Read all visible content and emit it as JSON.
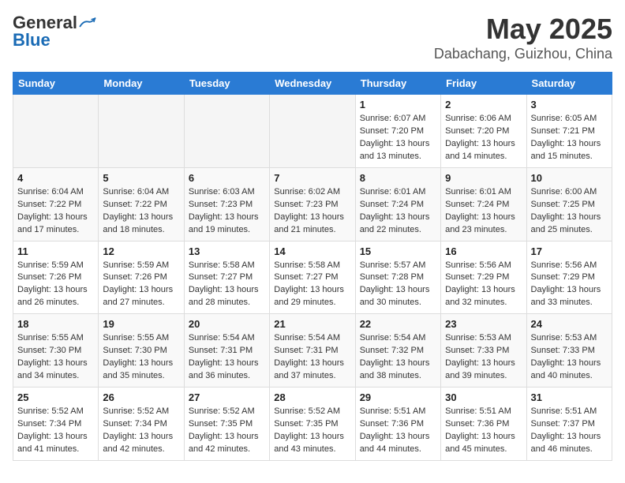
{
  "header": {
    "logo_general": "General",
    "logo_blue": "Blue",
    "month_year": "May 2025",
    "location": "Dabachang, Guizhou, China"
  },
  "days_of_week": [
    "Sunday",
    "Monday",
    "Tuesday",
    "Wednesday",
    "Thursday",
    "Friday",
    "Saturday"
  ],
  "weeks": [
    [
      {
        "day": "",
        "empty": true
      },
      {
        "day": "",
        "empty": true
      },
      {
        "day": "",
        "empty": true
      },
      {
        "day": "",
        "empty": true
      },
      {
        "day": "1",
        "sunrise": "6:07 AM",
        "sunset": "7:20 PM",
        "daylight": "13 hours and 13 minutes."
      },
      {
        "day": "2",
        "sunrise": "6:06 AM",
        "sunset": "7:20 PM",
        "daylight": "13 hours and 14 minutes."
      },
      {
        "day": "3",
        "sunrise": "6:05 AM",
        "sunset": "7:21 PM",
        "daylight": "13 hours and 15 minutes."
      }
    ],
    [
      {
        "day": "4",
        "sunrise": "6:04 AM",
        "sunset": "7:22 PM",
        "daylight": "13 hours and 17 minutes."
      },
      {
        "day": "5",
        "sunrise": "6:04 AM",
        "sunset": "7:22 PM",
        "daylight": "13 hours and 18 minutes."
      },
      {
        "day": "6",
        "sunrise": "6:03 AM",
        "sunset": "7:23 PM",
        "daylight": "13 hours and 19 minutes."
      },
      {
        "day": "7",
        "sunrise": "6:02 AM",
        "sunset": "7:23 PM",
        "daylight": "13 hours and 21 minutes."
      },
      {
        "day": "8",
        "sunrise": "6:01 AM",
        "sunset": "7:24 PM",
        "daylight": "13 hours and 22 minutes."
      },
      {
        "day": "9",
        "sunrise": "6:01 AM",
        "sunset": "7:24 PM",
        "daylight": "13 hours and 23 minutes."
      },
      {
        "day": "10",
        "sunrise": "6:00 AM",
        "sunset": "7:25 PM",
        "daylight": "13 hours and 25 minutes."
      }
    ],
    [
      {
        "day": "11",
        "sunrise": "5:59 AM",
        "sunset": "7:26 PM",
        "daylight": "13 hours and 26 minutes."
      },
      {
        "day": "12",
        "sunrise": "5:59 AM",
        "sunset": "7:26 PM",
        "daylight": "13 hours and 27 minutes."
      },
      {
        "day": "13",
        "sunrise": "5:58 AM",
        "sunset": "7:27 PM",
        "daylight": "13 hours and 28 minutes."
      },
      {
        "day": "14",
        "sunrise": "5:58 AM",
        "sunset": "7:27 PM",
        "daylight": "13 hours and 29 minutes."
      },
      {
        "day": "15",
        "sunrise": "5:57 AM",
        "sunset": "7:28 PM",
        "daylight": "13 hours and 30 minutes."
      },
      {
        "day": "16",
        "sunrise": "5:56 AM",
        "sunset": "7:29 PM",
        "daylight": "13 hours and 32 minutes."
      },
      {
        "day": "17",
        "sunrise": "5:56 AM",
        "sunset": "7:29 PM",
        "daylight": "13 hours and 33 minutes."
      }
    ],
    [
      {
        "day": "18",
        "sunrise": "5:55 AM",
        "sunset": "7:30 PM",
        "daylight": "13 hours and 34 minutes."
      },
      {
        "day": "19",
        "sunrise": "5:55 AM",
        "sunset": "7:30 PM",
        "daylight": "13 hours and 35 minutes."
      },
      {
        "day": "20",
        "sunrise": "5:54 AM",
        "sunset": "7:31 PM",
        "daylight": "13 hours and 36 minutes."
      },
      {
        "day": "21",
        "sunrise": "5:54 AM",
        "sunset": "7:31 PM",
        "daylight": "13 hours and 37 minutes."
      },
      {
        "day": "22",
        "sunrise": "5:54 AM",
        "sunset": "7:32 PM",
        "daylight": "13 hours and 38 minutes."
      },
      {
        "day": "23",
        "sunrise": "5:53 AM",
        "sunset": "7:33 PM",
        "daylight": "13 hours and 39 minutes."
      },
      {
        "day": "24",
        "sunrise": "5:53 AM",
        "sunset": "7:33 PM",
        "daylight": "13 hours and 40 minutes."
      }
    ],
    [
      {
        "day": "25",
        "sunrise": "5:52 AM",
        "sunset": "7:34 PM",
        "daylight": "13 hours and 41 minutes."
      },
      {
        "day": "26",
        "sunrise": "5:52 AM",
        "sunset": "7:34 PM",
        "daylight": "13 hours and 42 minutes."
      },
      {
        "day": "27",
        "sunrise": "5:52 AM",
        "sunset": "7:35 PM",
        "daylight": "13 hours and 42 minutes."
      },
      {
        "day": "28",
        "sunrise": "5:52 AM",
        "sunset": "7:35 PM",
        "daylight": "13 hours and 43 minutes."
      },
      {
        "day": "29",
        "sunrise": "5:51 AM",
        "sunset": "7:36 PM",
        "daylight": "13 hours and 44 minutes."
      },
      {
        "day": "30",
        "sunrise": "5:51 AM",
        "sunset": "7:36 PM",
        "daylight": "13 hours and 45 minutes."
      },
      {
        "day": "31",
        "sunrise": "5:51 AM",
        "sunset": "7:37 PM",
        "daylight": "13 hours and 46 minutes."
      }
    ]
  ]
}
